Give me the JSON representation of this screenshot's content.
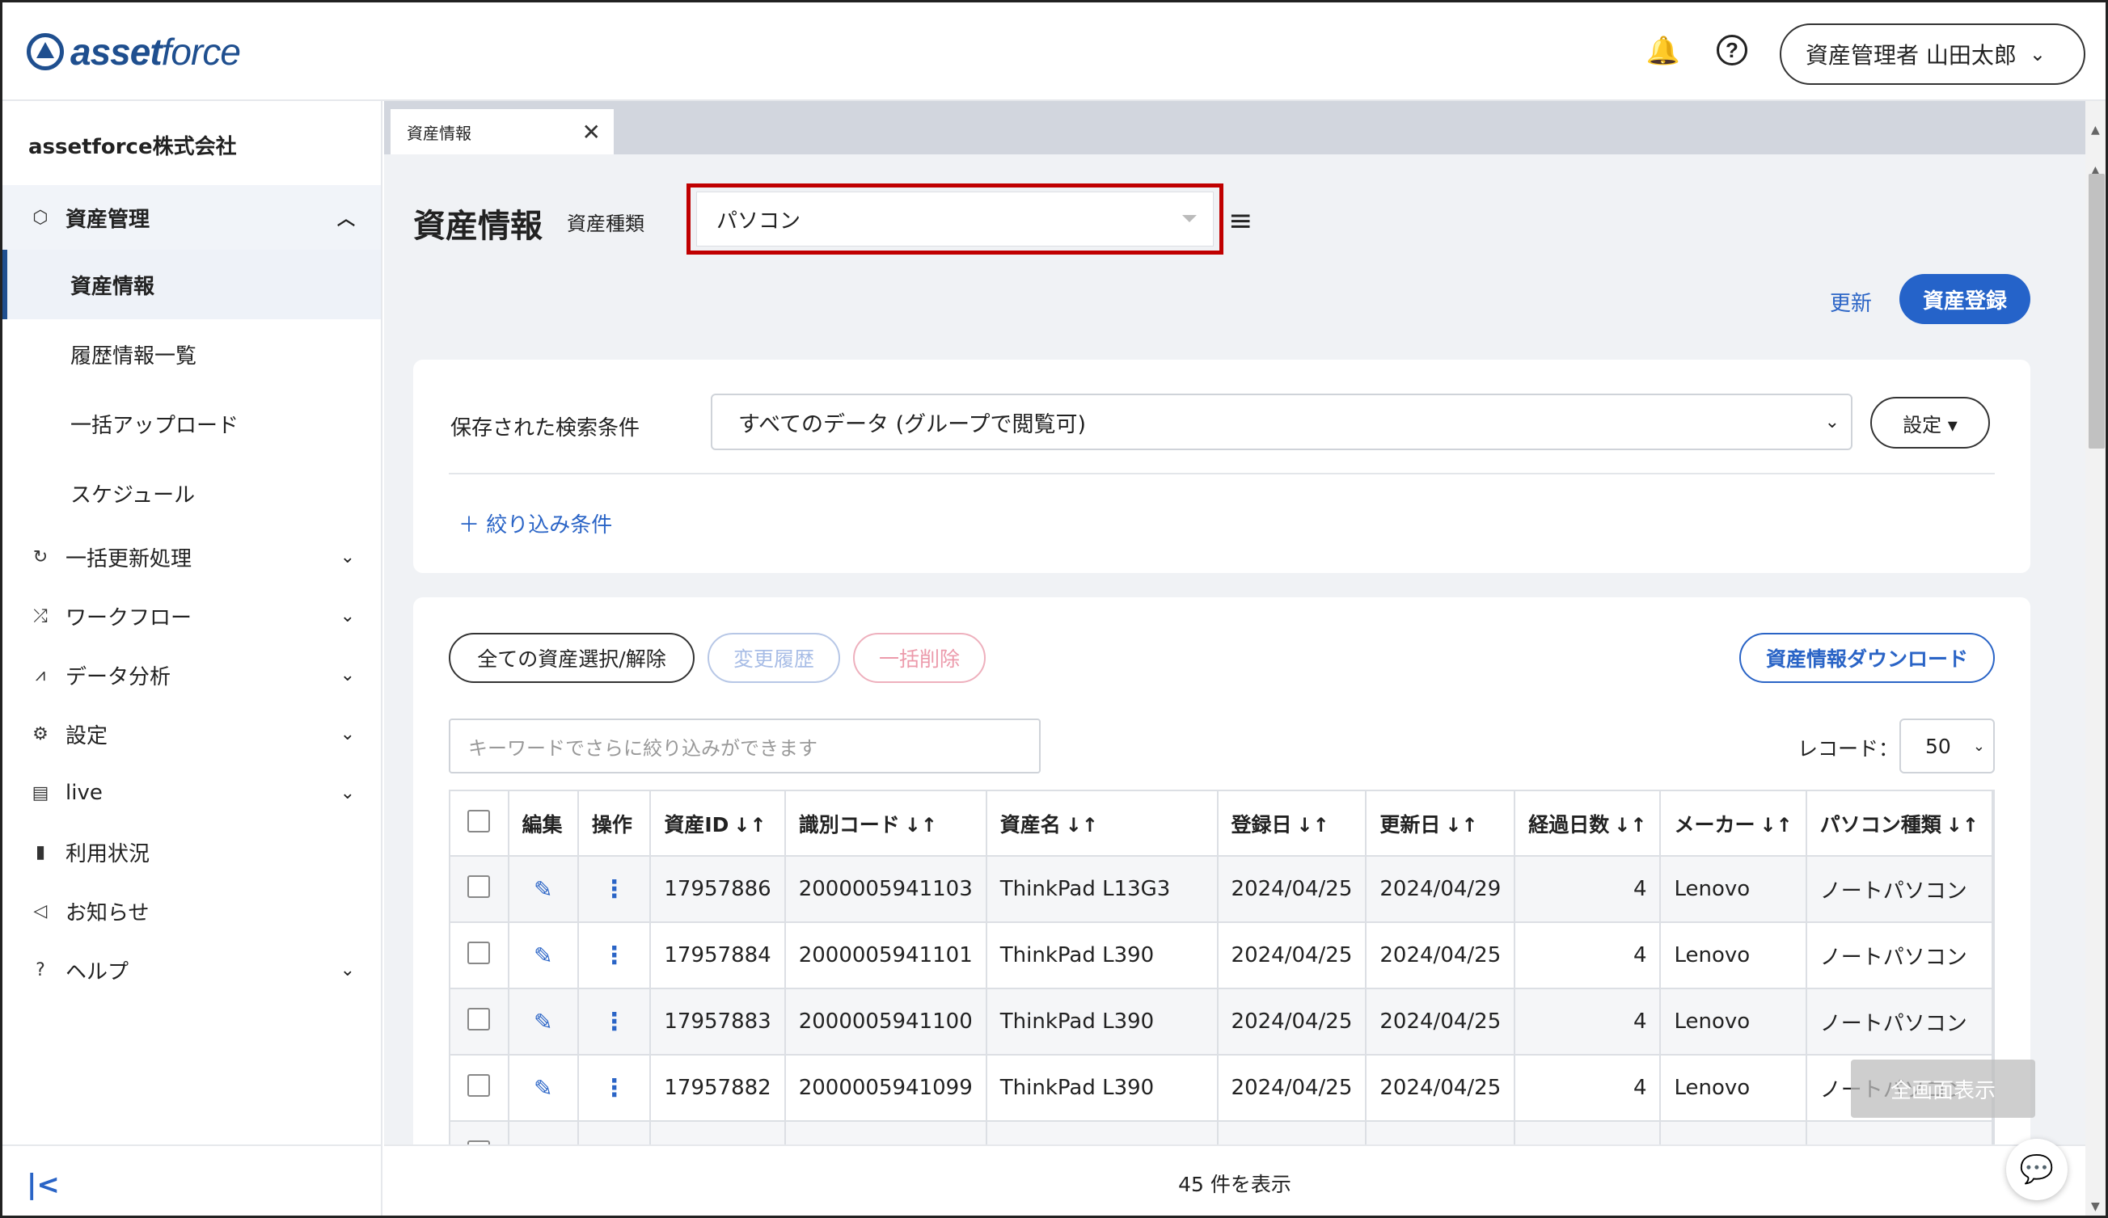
{
  "header": {
    "logo_prefix": "asset",
    "logo_suffix": "force",
    "bell_icon": "🔔",
    "help_icon": "?",
    "user_label": "資産管理者 山田太郎",
    "user_chevron": "⌄"
  },
  "sidebar": {
    "company": "assetforce株式会社",
    "group_active": {
      "label": "資産管理",
      "icon": "⬡",
      "chevron": "︿"
    },
    "sub_items": [
      {
        "label": "資産情報"
      },
      {
        "label": "履歴情報一覧"
      },
      {
        "label": "一括アップロード"
      },
      {
        "label": "スケジュール"
      }
    ],
    "items": [
      {
        "label": "一括更新処理",
        "icon": "↻",
        "chevron": "⌄"
      },
      {
        "label": "ワークフロー",
        "icon": "⤮",
        "chevron": "⌄"
      },
      {
        "label": "データ分析",
        "icon": "⩘",
        "chevron": "⌄"
      },
      {
        "label": "設定",
        "icon": "⚙",
        "chevron": "⌄"
      },
      {
        "label": "live",
        "icon": "▤",
        "chevron": "⌄"
      },
      {
        "label": "利用状況",
        "icon": "▮",
        "chevron": ""
      },
      {
        "label": "お知らせ",
        "icon": "◁",
        "chevron": ""
      },
      {
        "label": "ヘルプ",
        "icon": "?",
        "chevron": "⌄"
      }
    ],
    "collapse_icon": "|<"
  },
  "tab": {
    "label": "資産情報",
    "close_icon": "✕"
  },
  "page": {
    "title": "資産情報",
    "type_label": "資産種類",
    "type_value": "パソコン",
    "menu_icon": "≡",
    "update_link": "更新",
    "register_button": "資産登録"
  },
  "search": {
    "saved_label": "保存された検索条件",
    "saved_value": "すべてのデータ (グループで閲覧可)",
    "saved_chevron": "⌄",
    "setting_button": "設定 ▾",
    "filter_link": "＋ 絞り込み条件"
  },
  "actions": {
    "select_all": "全ての資産選択/解除",
    "history": "変更履歴",
    "bulk_delete": "一括削除",
    "download": "資産情報ダウンロード",
    "keyword_placeholder": "キーワードでさらに絞り込みができます",
    "record_label": "レコード：",
    "record_value": "50",
    "record_chevron": "⌄"
  },
  "table": {
    "headers": [
      "",
      "編集",
      "操作",
      "資産ID",
      "識別コード",
      "資産名",
      "登録日",
      "更新日",
      "経過日数",
      "メーカー",
      "パソコン種類"
    ],
    "sort_icon": "↓↑",
    "edit_icon": "✎",
    "kebab_icon": "⋮",
    "rows": [
      {
        "id": "17957886",
        "code": "2000005941103",
        "name": "ThinkPad L13G3",
        "registered": "2024/04/25",
        "updated": "2024/04/29",
        "days": "4",
        "maker": "Lenovo",
        "type": "ノートパソコン"
      },
      {
        "id": "17957884",
        "code": "2000005941101",
        "name": "ThinkPad L390",
        "registered": "2024/04/25",
        "updated": "2024/04/25",
        "days": "4",
        "maker": "Lenovo",
        "type": "ノートパソコン"
      },
      {
        "id": "17957883",
        "code": "2000005941100",
        "name": "ThinkPad L390",
        "registered": "2024/04/25",
        "updated": "2024/04/25",
        "days": "4",
        "maker": "Lenovo",
        "type": "ノートパソコン"
      },
      {
        "id": "17957882",
        "code": "2000005941099",
        "name": "ThinkPad L390",
        "registered": "2024/04/25",
        "updated": "2024/04/25",
        "days": "4",
        "maker": "Lenovo",
        "type": "ノートパソコン"
      }
    ]
  },
  "footer": {
    "count_text": "45 件を表示"
  },
  "overlay": {
    "fullscreen_label": "全画面表示",
    "chat_icon": "💬"
  },
  "colors": {
    "accent": "#2563c9",
    "brand": "#1f4f8f",
    "highlight_border": "#c00000"
  }
}
